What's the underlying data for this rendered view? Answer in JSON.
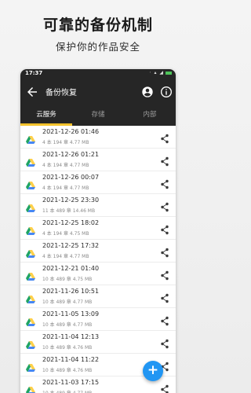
{
  "promo": {
    "title": "可靠的备份机制",
    "subtitle": "保护你的作品安全"
  },
  "status_bar": {
    "time": "17:37",
    "icons": "⋅ ▴ ◢"
  },
  "app_bar": {
    "title": "备份恢复",
    "icons": {
      "back": "arrow-back-icon",
      "account": "account-icon",
      "info": "info-icon"
    }
  },
  "tabs": [
    {
      "label": "云服务",
      "active": true
    },
    {
      "label": "存储",
      "active": false
    },
    {
      "label": "内部",
      "active": false
    }
  ],
  "backups": [
    {
      "date": "2021-12-26 01:46",
      "meta": "4 本 194 章  4.77 MB"
    },
    {
      "date": "2021-12-26 01:21",
      "meta": "4 本 194 章  4.77 MB"
    },
    {
      "date": "2021-12-26 00:07",
      "meta": "4 本 194 章  4.77 MB"
    },
    {
      "date": "2021-12-25 23:30",
      "meta": "11 本 489 章  14.46 MB"
    },
    {
      "date": "2021-12-25 18:02",
      "meta": "4 本 194 章  4.75 MB"
    },
    {
      "date": "2021-12-25 17:32",
      "meta": "4 本 194 章  4.77 MB"
    },
    {
      "date": "2021-12-21 01:40",
      "meta": "10 本 489 章  4.75 MB"
    },
    {
      "date": "2021-11-26 10:51",
      "meta": "10 本 489 章  4.77 MB"
    },
    {
      "date": "2021-11-05 13:09",
      "meta": "10 本 489 章  4.77 MB"
    },
    {
      "date": "2021-11-04 12:13",
      "meta": "10 本 489 章  4.76 MB"
    },
    {
      "date": "2021-11-04 11:22",
      "meta": "10 本 489 章  4.76 MB"
    },
    {
      "date": "2021-11-03 17:15",
      "meta": "10 本 489 章  4.77 MB"
    }
  ],
  "fab": {
    "label": "+"
  },
  "colors": {
    "header": "#262626",
    "tab_indicator": "#f3c22c",
    "fab": "#2196f3",
    "drive_green": "#1fa463",
    "drive_yellow": "#ffd04b",
    "drive_blue": "#4687f4"
  }
}
